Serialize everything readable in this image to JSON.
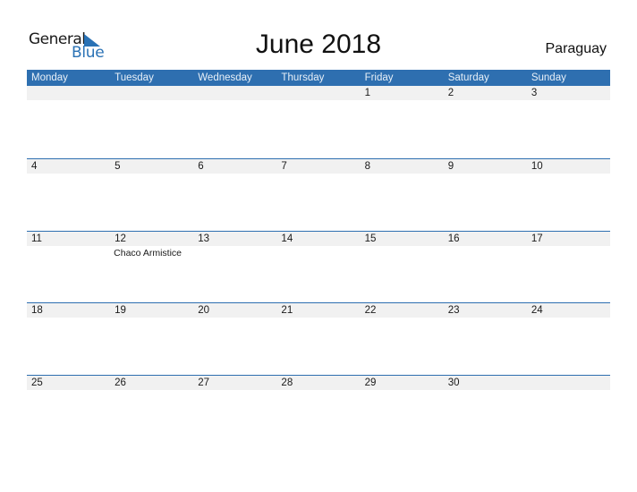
{
  "logo": {
    "word1": "General",
    "word2": "Blue",
    "icon": "triangle-flag-icon",
    "accent": "#2a72b5"
  },
  "title": "June 2018",
  "country": "Paraguay",
  "colors": {
    "header_bg": "#2e6fb0",
    "band_bg": "#f1f1f1"
  },
  "weekdays": [
    "Monday",
    "Tuesday",
    "Wednesday",
    "Thursday",
    "Friday",
    "Saturday",
    "Sunday"
  ],
  "weeks": [
    {
      "days": [
        "",
        "",
        "",
        "",
        "1",
        "2",
        "3"
      ],
      "events": [
        "",
        "",
        "",
        "",
        "",
        "",
        ""
      ]
    },
    {
      "days": [
        "4",
        "5",
        "6",
        "7",
        "8",
        "9",
        "10"
      ],
      "events": [
        "",
        "",
        "",
        "",
        "",
        "",
        ""
      ]
    },
    {
      "days": [
        "11",
        "12",
        "13",
        "14",
        "15",
        "16",
        "17"
      ],
      "events": [
        "",
        "Chaco Armistice",
        "",
        "",
        "",
        "",
        ""
      ]
    },
    {
      "days": [
        "18",
        "19",
        "20",
        "21",
        "22",
        "23",
        "24"
      ],
      "events": [
        "",
        "",
        "",
        "",
        "",
        "",
        ""
      ]
    },
    {
      "days": [
        "25",
        "26",
        "27",
        "28",
        "29",
        "30",
        ""
      ],
      "events": [
        "",
        "",
        "",
        "",
        "",
        "",
        ""
      ]
    }
  ]
}
